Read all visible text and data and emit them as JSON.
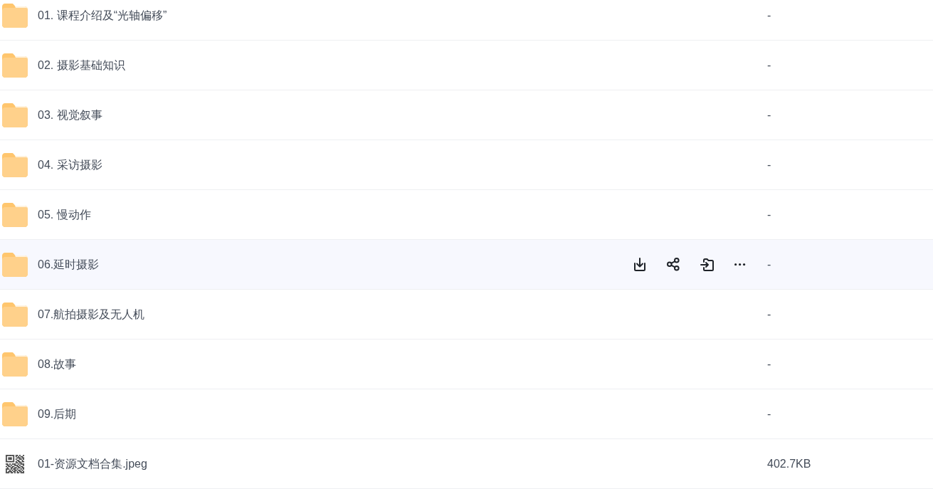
{
  "files": [
    {
      "kind": "folder",
      "name": "01. 课程介绍及“光轴偏移”",
      "size": "-",
      "hovered": false
    },
    {
      "kind": "folder",
      "name": "02. 摄影基础知识",
      "size": "-",
      "hovered": false
    },
    {
      "kind": "folder",
      "name": "03. 视觉叙事",
      "size": "-",
      "hovered": false
    },
    {
      "kind": "folder",
      "name": "04. 采访摄影",
      "size": "-",
      "hovered": false
    },
    {
      "kind": "folder",
      "name": "05. 慢动作",
      "size": "-",
      "hovered": false
    },
    {
      "kind": "folder",
      "name": "06.延时摄影",
      "size": "-",
      "hovered": true
    },
    {
      "kind": "folder",
      "name": "07.航拍摄影及无人机",
      "size": "-",
      "hovered": false
    },
    {
      "kind": "folder",
      "name": "08.故事",
      "size": "-",
      "hovered": false
    },
    {
      "kind": "folder",
      "name": "09.后期",
      "size": "-",
      "hovered": false
    },
    {
      "kind": "image",
      "name": "01-资源文档合集.jpeg",
      "size": "402.7KB",
      "hovered": false
    }
  ]
}
